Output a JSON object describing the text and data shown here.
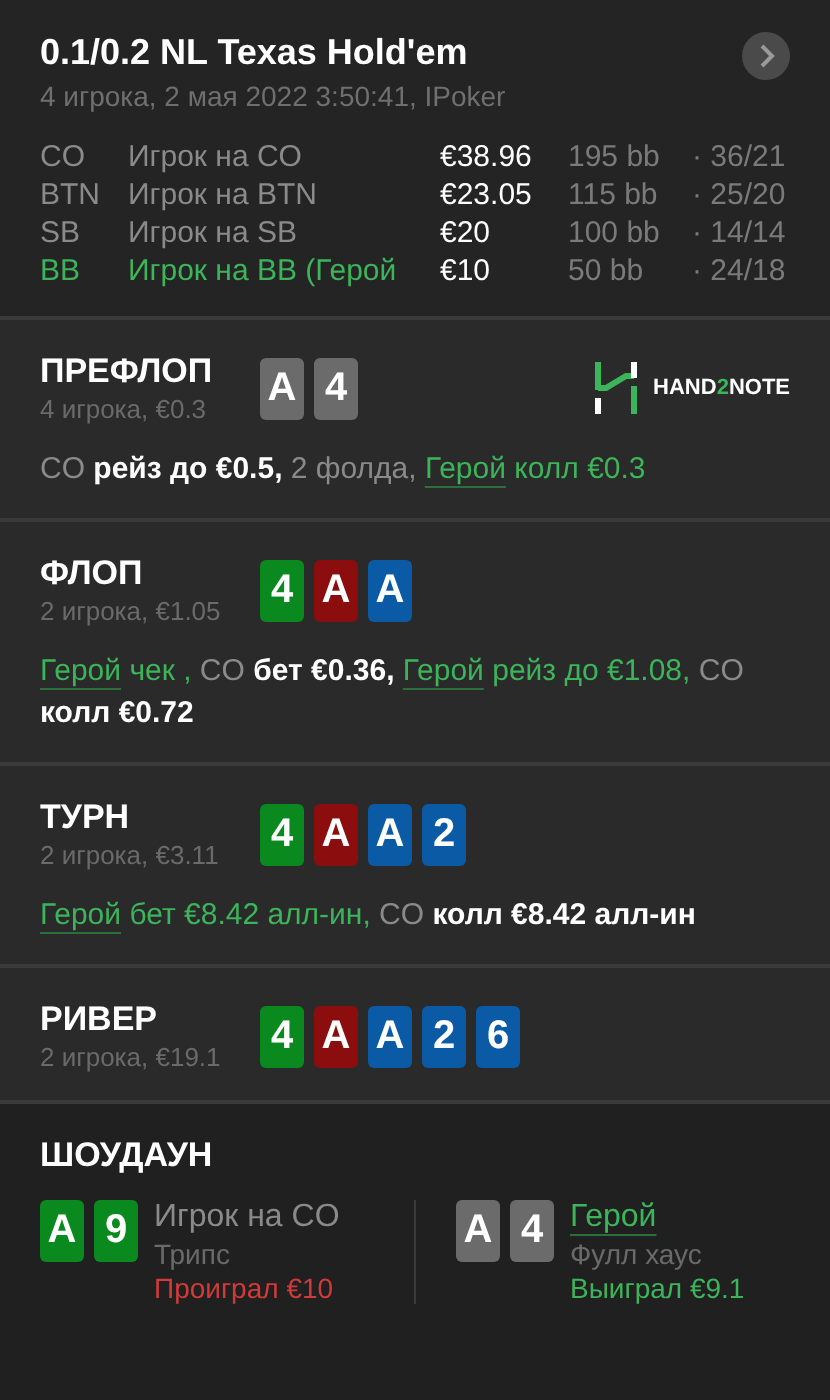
{
  "header": {
    "title": "0.1/0.2 NL Texas Hold'em",
    "subtitle": "4 игрока, 2 мая 2022 3:50:41, IPoker",
    "next_button": true
  },
  "players": [
    {
      "position": "CO",
      "name": "Игрок на CO",
      "stack": "€38.96",
      "bb": "195 bb",
      "stats": "· 36/21",
      "hero": false
    },
    {
      "position": "BTN",
      "name": "Игрок на BTN",
      "stack": "€23.05",
      "bb": "115 bb",
      "stats": "· 25/20",
      "hero": false
    },
    {
      "position": "SB",
      "name": "Игрок на SB",
      "stack": "€20",
      "bb": "100 bb",
      "stats": "· 14/14",
      "hero": false
    },
    {
      "position": "BB",
      "name": "Игрок на BB (Герой",
      "stack": "€10",
      "bb": "50 bb",
      "stats": "· 24/18",
      "hero": true
    }
  ],
  "streets": [
    {
      "title": "ПРЕФЛОП",
      "info": "4 игрока, €0.3",
      "cards": [
        {
          "rank": "A",
          "color": "#6b6b6b"
        },
        {
          "rank": "4",
          "color": "#6b6b6b"
        }
      ],
      "logo": [
        {
          "text": "HAND",
          "accent": false
        },
        {
          "text": "2",
          "accent": true
        },
        {
          "text": "NOTE",
          "accent": false
        }
      ],
      "actions": [
        {
          "text": "CO",
          "kind": "other"
        },
        {
          "text": " рейз до €0.5,",
          "kind": "bold"
        },
        {
          "text": " 2 фолда, ",
          "kind": "other"
        },
        {
          "text": "Герой",
          "kind": "link"
        },
        {
          "text": " колл €0.3",
          "kind": "hero"
        }
      ]
    },
    {
      "title": "ФЛОП",
      "info": "2 игрока, €1.05",
      "cards": [
        {
          "rank": "4",
          "color": "#0a8a1e"
        },
        {
          "rank": "A",
          "color": "#8b0d0d"
        },
        {
          "rank": "A",
          "color": "#0b5aa6"
        }
      ],
      "actions": [
        {
          "text": "Герой",
          "kind": "link"
        },
        {
          "text": " чек ,",
          "kind": "hero"
        },
        {
          "text": " CO",
          "kind": "other"
        },
        {
          "text": " бет €0.36, ",
          "kind": "bold"
        },
        {
          "text": "Герой",
          "kind": "link"
        },
        {
          "text": " рейз до €1.08,",
          "kind": "hero"
        },
        {
          "text": " CO",
          "kind": "other"
        },
        {
          "text": " колл €0.72",
          "kind": "bold"
        }
      ]
    },
    {
      "title": "ТУРН",
      "info": "2 игрока, €3.11",
      "cards": [
        {
          "rank": "4",
          "color": "#0a8a1e"
        },
        {
          "rank": "A",
          "color": "#8b0d0d"
        },
        {
          "rank": "A",
          "color": "#0b5aa6"
        },
        {
          "rank": "2",
          "color": "#0b5aa6"
        }
      ],
      "actions": [
        {
          "text": "Герой",
          "kind": "link"
        },
        {
          "text": " бет €8.42 алл-ин,",
          "kind": "hero"
        },
        {
          "text": " CO",
          "kind": "other"
        },
        {
          "text": " колл €8.42 алл-ин",
          "kind": "bold"
        }
      ]
    },
    {
      "title": "РИВЕР",
      "info": "2 игрока, €19.1",
      "cards": [
        {
          "rank": "4",
          "color": "#0a8a1e"
        },
        {
          "rank": "A",
          "color": "#8b0d0d"
        },
        {
          "rank": "A",
          "color": "#0b5aa6"
        },
        {
          "rank": "2",
          "color": "#0b5aa6"
        },
        {
          "rank": "6",
          "color": "#0b5aa6"
        }
      ]
    }
  ],
  "showdown": {
    "title": "ШОУДАУН",
    "players": [
      {
        "cards": [
          {
            "rank": "A",
            "color": "#0a8a1e"
          },
          {
            "rank": "9",
            "color": "#0a8a1e"
          }
        ],
        "name": "Игрок на CO",
        "hero": false,
        "hand": "Трипс",
        "result": "Проиграл €10",
        "won": false
      },
      {
        "cards": [
          {
            "rank": "A",
            "color": "#6b6b6b"
          },
          {
            "rank": "4",
            "color": "#6b6b6b"
          }
        ],
        "name": "Герой",
        "hero": true,
        "hand": "Фулл хаус",
        "result": "Выиграл €9.1",
        "won": true
      }
    ]
  }
}
